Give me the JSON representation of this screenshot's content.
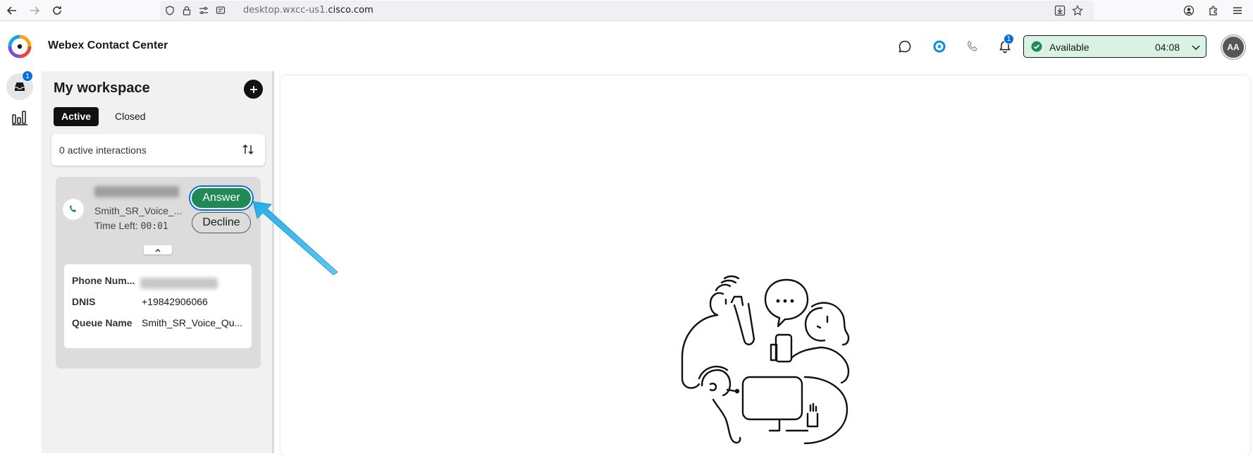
{
  "browser": {
    "url_prefix": "desktop.wxcc-us1.",
    "url_domain": "cisco.com"
  },
  "header": {
    "app_title": "Webex Contact Center",
    "notification_count": "1",
    "status": {
      "label": "Available",
      "timer": "04:08",
      "color": "#d8f3e4"
    },
    "avatar_initials": "AA"
  },
  "rail": {
    "inbox_badge": "1"
  },
  "workspace": {
    "title": "My workspace",
    "tabs": [
      {
        "label": "Active",
        "selected": true
      },
      {
        "label": "Closed",
        "selected": false
      }
    ],
    "active_count_text": "0 active interactions",
    "call": {
      "queue": "Smith_SR_Voice_...",
      "time_left_label": "Time Left:",
      "time_left_value": "00:01",
      "answer_label": "Answer",
      "decline_label": "Decline",
      "answer_color": "#1f8a57",
      "details": [
        {
          "label": "Phone Num...",
          "value": ""
        },
        {
          "label": "DNIS",
          "value": "+19842906066"
        },
        {
          "label": "Queue Name",
          "value": "Smith_SR_Voice_Qu..."
        }
      ]
    }
  },
  "accent_colors": {
    "badge": "#0a6fd6",
    "pointer_arrow": "#29aee6"
  }
}
